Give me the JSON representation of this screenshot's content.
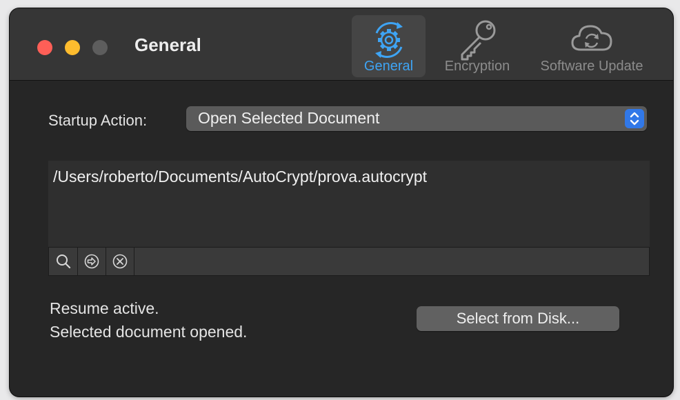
{
  "window": {
    "title": "General"
  },
  "toolbar": {
    "tabs": [
      {
        "label": "General",
        "icon": "gear-icon",
        "selected": true
      },
      {
        "label": "Encryption",
        "icon": "key-icon",
        "selected": false
      },
      {
        "label": "Software Update",
        "icon": "cloud-sync-icon",
        "selected": false
      }
    ]
  },
  "startup": {
    "label": "Startup Action:",
    "selected_value": "Open Selected Document"
  },
  "document": {
    "path": "/Users/roberto/Documents/AutoCrypt/prova.autocrypt",
    "actions": [
      "search-icon",
      "reveal-arrow-icon",
      "clear-icon"
    ]
  },
  "status": {
    "line1": "Resume active.",
    "line2": "Selected document opened."
  },
  "buttons": {
    "select_from_disk": "Select from Disk..."
  },
  "colors": {
    "accent": "#3ea4f4",
    "stepper": "#3178e8",
    "window_bg": "#262626",
    "close": "#fe5f57",
    "minimize": "#febc2e",
    "zoom_disabled": "#5d5d5d"
  }
}
